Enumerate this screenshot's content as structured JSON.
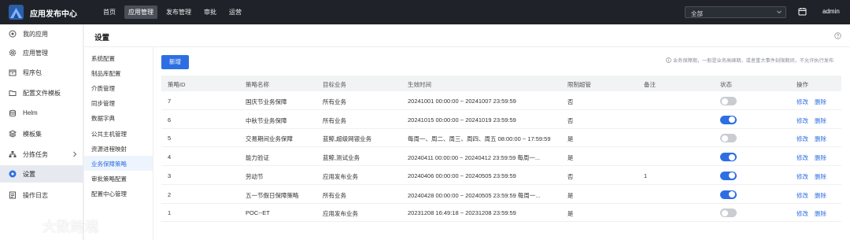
{
  "app": {
    "title": "应用发布中心"
  },
  "topnav": [
    {
      "label": "首页",
      "active": false
    },
    {
      "label": "应用管理",
      "active": true
    },
    {
      "label": "发布管理",
      "active": false
    },
    {
      "label": "审批",
      "active": false
    },
    {
      "label": "运营",
      "active": false
    }
  ],
  "scope_select": {
    "value": "全部"
  },
  "user": {
    "name": "admin"
  },
  "sidebar": {
    "items": [
      {
        "label": "我的应用",
        "icon": "target-icon",
        "active": false,
        "has_arrow": false
      },
      {
        "label": "应用管理",
        "icon": "gear-icon",
        "active": false,
        "has_arrow": false
      },
      {
        "label": "程序包",
        "icon": "package-icon",
        "active": false,
        "has_arrow": false
      },
      {
        "label": "配置文件模板",
        "icon": "folder-icon",
        "active": false,
        "has_arrow": false
      },
      {
        "label": "Helm",
        "icon": "database-icon",
        "active": false,
        "has_arrow": false
      },
      {
        "label": "模板集",
        "icon": "layers-icon",
        "active": false,
        "has_arrow": false
      },
      {
        "label": "分拣任务",
        "icon": "tree-icon",
        "active": false,
        "has_arrow": true
      },
      {
        "label": "设置",
        "icon": "settings-icon",
        "active": true,
        "has_arrow": false
      },
      {
        "label": "操作日志",
        "icon": "log-icon",
        "active": false,
        "has_arrow": false
      }
    ]
  },
  "page": {
    "title": "设置"
  },
  "submenu": {
    "items": [
      {
        "label": "系统配置",
        "active": false
      },
      {
        "label": "制品库配置",
        "active": false
      },
      {
        "label": "介质管理",
        "active": false
      },
      {
        "label": "同步管理",
        "active": false
      },
      {
        "label": "数据字典",
        "active": false
      },
      {
        "label": "公共主机管理",
        "active": false
      },
      {
        "label": "资源进程映射",
        "active": false
      },
      {
        "label": "业务保障策略",
        "active": true
      },
      {
        "label": "审批策略配置",
        "active": false
      },
      {
        "label": "配置中心管理",
        "active": false
      }
    ]
  },
  "toolbar": {
    "new_label": "新增",
    "hint": "业务保障期，一般是业务高峰期，或者重大事件刻限期间，不允许执行发布"
  },
  "table": {
    "headers": [
      "策略ID",
      "策略名称",
      "目标业务",
      "生效时间",
      "限制超管",
      "备注",
      "状态",
      "操作"
    ],
    "rows": [
      {
        "id": "7",
        "name": "国庆节业务保障",
        "target": "所有业务",
        "time": "20241001 00:00:00 ~ 20241007 23:59:59",
        "limit": "否",
        "note": "",
        "enabled": false,
        "edit": "修改",
        "delete": "删除"
      },
      {
        "id": "6",
        "name": "中秋节业务保障",
        "target": "所有业务",
        "time": "20241015 00:00:00 ~ 20241019 23:59:59",
        "limit": "否",
        "note": "",
        "enabled": true,
        "edit": "修改",
        "delete": "删除"
      },
      {
        "id": "5",
        "name": "交易期间业务保障",
        "target": "蓝鲸,超级网银业务",
        "time": "每周一、周二、周三、周四、周五 08:00:00 ~ 17:59:59",
        "limit": "是",
        "note": "",
        "enabled": false,
        "edit": "修改",
        "delete": "删除"
      },
      {
        "id": "4",
        "name": "能力验证",
        "target": "蓝鲸,测试业务",
        "time": "20240411 00:00:00 ~ 20240412 23:59:59 每周一...",
        "limit": "是",
        "note": "",
        "enabled": true,
        "edit": "修改",
        "delete": "删除"
      },
      {
        "id": "3",
        "name": "劳动节",
        "target": "应用发布业务",
        "time": "20240406 00:00:00 ~ 20240505 23:59:59",
        "limit": "否",
        "note": "1",
        "enabled": true,
        "edit": "修改",
        "delete": "删除"
      },
      {
        "id": "2",
        "name": "五一节假日保障策略",
        "target": "所有业务",
        "time": "20240428 00:00:00 ~ 20240505 23:59:59 每周一...",
        "limit": "是",
        "note": "",
        "enabled": true,
        "edit": "修改",
        "delete": "删除"
      },
      {
        "id": "1",
        "name": "POC--ET",
        "target": "应用发布业务",
        "time": "20231208 16:49:18 ~ 20231208 23:59:59",
        "limit": "是",
        "note": "",
        "enabled": false,
        "edit": "修改",
        "delete": "删除"
      }
    ]
  },
  "watermark": {
    "text": "大数跨境"
  },
  "colors": {
    "primary": "#2d6fe3",
    "topbar": "#1f2329",
    "toggle_off": "#c9ccd1"
  }
}
